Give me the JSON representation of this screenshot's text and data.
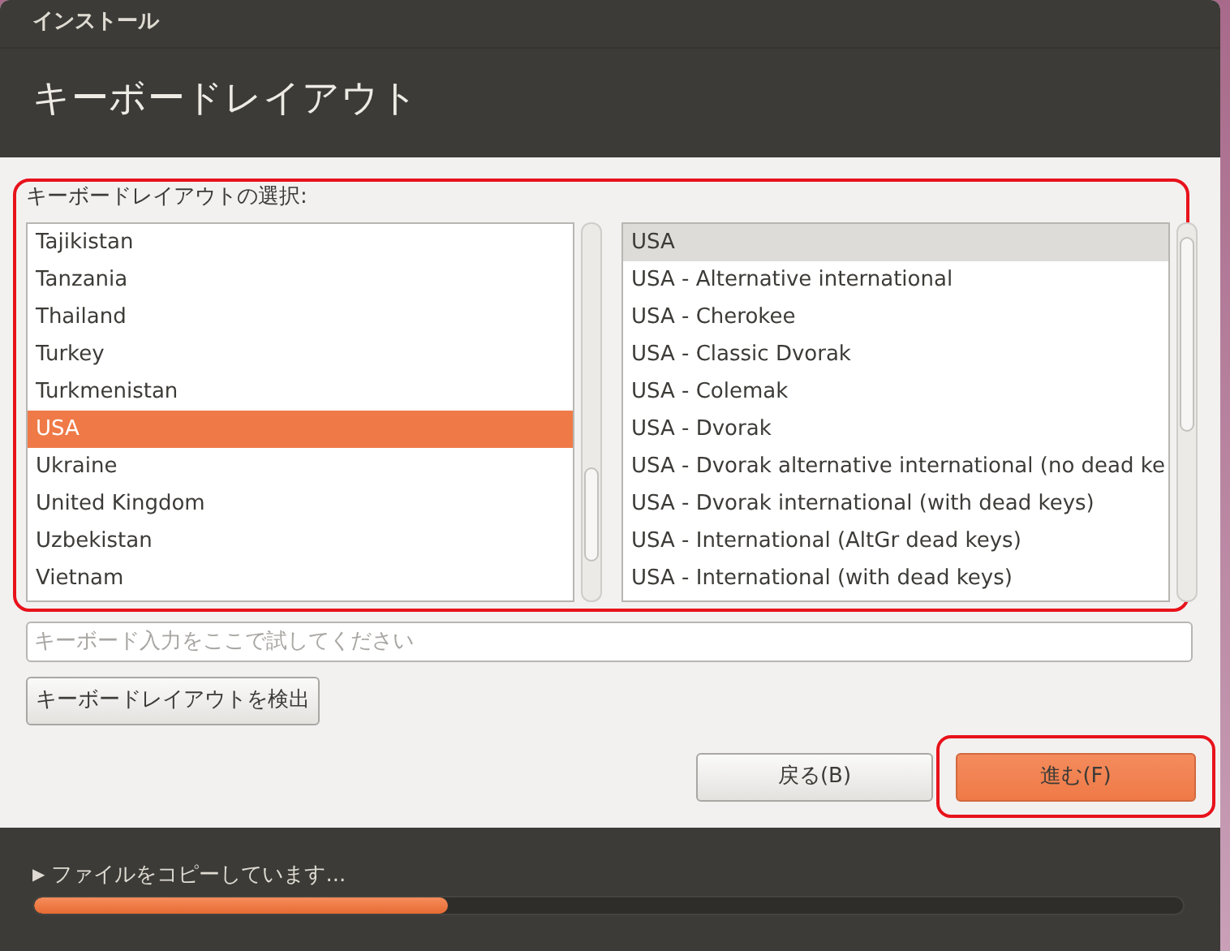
{
  "window": {
    "title": "インストール"
  },
  "page_title": "キーボードレイアウト",
  "layout_label": "キーボードレイアウトの選択:",
  "countries": [
    {
      "label": "Tajikistan",
      "selected": false
    },
    {
      "label": "Tanzania",
      "selected": false
    },
    {
      "label": "Thailand",
      "selected": false
    },
    {
      "label": "Turkey",
      "selected": false
    },
    {
      "label": "Turkmenistan",
      "selected": false
    },
    {
      "label": "USA",
      "selected": true
    },
    {
      "label": "Ukraine",
      "selected": false
    },
    {
      "label": "United Kingdom",
      "selected": false
    },
    {
      "label": "Uzbekistan",
      "selected": false
    },
    {
      "label": "Vietnam",
      "selected": false
    }
  ],
  "variants": [
    {
      "label": "USA",
      "selected": true
    },
    {
      "label": "USA - Alternative international",
      "selected": false
    },
    {
      "label": "USA - Cherokee",
      "selected": false
    },
    {
      "label": "USA - Classic Dvorak",
      "selected": false
    },
    {
      "label": "USA - Colemak",
      "selected": false
    },
    {
      "label": "USA - Dvorak",
      "selected": false
    },
    {
      "label": "USA - Dvorak alternative international (no dead ke",
      "selected": false
    },
    {
      "label": "USA - Dvorak international (with dead keys)",
      "selected": false
    },
    {
      "label": "USA - International (AltGr dead keys)",
      "selected": false
    },
    {
      "label": "USA - International (with dead keys)",
      "selected": false
    }
  ],
  "test_field": {
    "placeholder": "キーボード入力をここで試してください"
  },
  "detect_button": "キーボードレイアウトを検出",
  "buttons": [
    {
      "label": "戻る(B)",
      "kind": "secondary"
    },
    {
      "label": "進む(F)",
      "kind": "primary"
    }
  ],
  "progress": {
    "text": "ファイルをコピーしています...",
    "expander": "▶",
    "level": 0.36
  }
}
